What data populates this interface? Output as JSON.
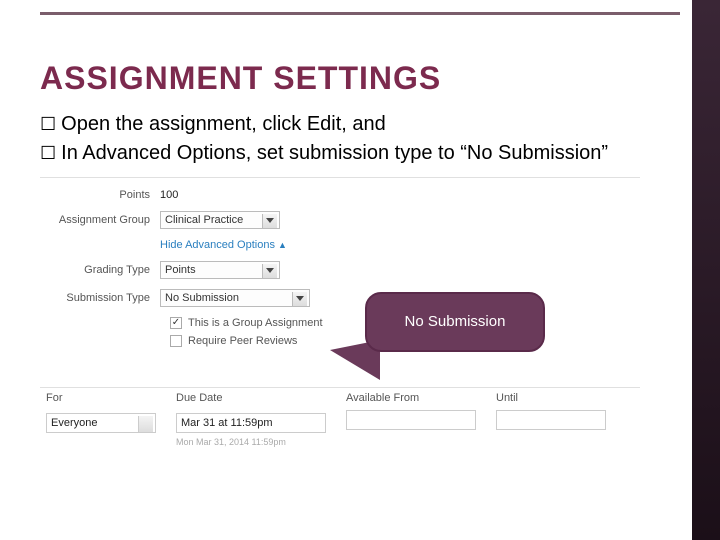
{
  "title": "ASSIGNMENT SETTINGS",
  "bullets": [
    "Open the assignment, click Edit, and",
    "In Advanced Options, set submission type to “No Submission”"
  ],
  "form": {
    "points_label": "Points",
    "points_value": "100",
    "group_label": "Assignment Group",
    "group_value": "Clinical Practice",
    "advanced_link": "Hide Advanced Options",
    "advanced_arrow": "▲",
    "grading_label": "Grading Type",
    "grading_value": "Points",
    "submission_label": "Submission Type",
    "submission_value": "No Submission",
    "group_chk_label": "This is a Group Assignment",
    "peer_chk_label": "Require Peer Reviews"
  },
  "due": {
    "h_for": "For",
    "h_due": "Due Date",
    "h_from": "Available From",
    "h_until": "Until",
    "for_value": "Everyone",
    "due_value": "Mar 31 at 11:59pm",
    "due_sub": "Mon Mar 31, 2014 11:59pm"
  },
  "callout": "No Submission"
}
